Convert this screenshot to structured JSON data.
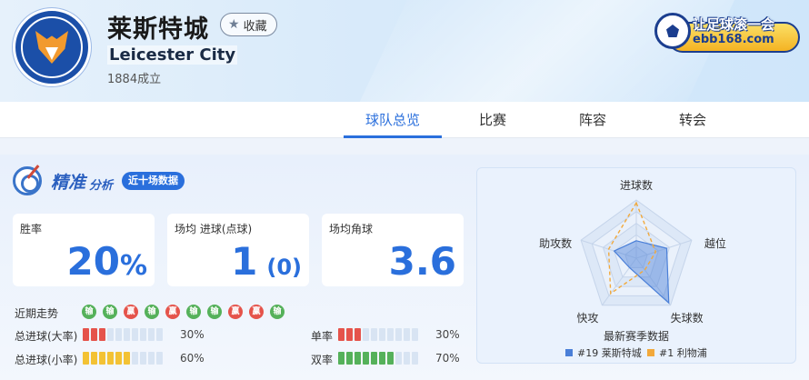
{
  "header": {
    "team_name_cn": "莱斯特城",
    "favorite_label": "收藏",
    "team_name_en": "Leicester City",
    "founded": "1884成立",
    "brand_title": "让足球滚一会",
    "brand_url": "ebb168.com"
  },
  "tabs": [
    {
      "label": "球队总览",
      "active": true
    },
    {
      "label": "比赛",
      "active": false
    },
    {
      "label": "阵容",
      "active": false
    },
    {
      "label": "转会",
      "active": false
    }
  ],
  "analysis": {
    "title_main": "精准",
    "title_sub": "分析",
    "badge": "近十场数据"
  },
  "stats": {
    "win_rate": {
      "label": "胜率",
      "value": "20",
      "unit": "%"
    },
    "goals": {
      "label": "场均 进球(点球)",
      "value": "1",
      "sub": "(0)"
    },
    "corners": {
      "label": "场均角球",
      "value": "3.6"
    }
  },
  "recent_form": {
    "label": "近期走势",
    "results": [
      {
        "text": "输",
        "type": "lose"
      },
      {
        "text": "输",
        "type": "lose"
      },
      {
        "text": "赢",
        "type": "win"
      },
      {
        "text": "输",
        "type": "lose"
      },
      {
        "text": "赢",
        "type": "win"
      },
      {
        "text": "输",
        "type": "lose"
      },
      {
        "text": "输",
        "type": "lose"
      },
      {
        "text": "赢",
        "type": "win"
      },
      {
        "text": "赢",
        "type": "win"
      },
      {
        "text": "输",
        "type": "lose"
      }
    ]
  },
  "rates": {
    "over_big": {
      "label": "总进球(大率)",
      "value": "30%",
      "filled": 3,
      "color": "red"
    },
    "over_small": {
      "label": "总进球(小率)",
      "value": "60%",
      "filled": 6,
      "color": "yellow"
    },
    "odd": {
      "label": "单率",
      "value": "30%",
      "filled": 3,
      "color": "red"
    },
    "even": {
      "label": "双率",
      "value": "70%",
      "filled": 7,
      "color": "green"
    }
  },
  "radar": {
    "axes": [
      "进球数",
      "越位",
      "失球数",
      "快攻",
      "助攻数"
    ],
    "caption": "最新赛季数据",
    "series": [
      {
        "name": "#19 莱斯特城",
        "color": "#4a7fd8",
        "values": [
          0.3,
          0.55,
          0.95,
          0.2,
          0.4
        ]
      },
      {
        "name": "#1 利物浦",
        "color": "#f2a93b",
        "values": [
          0.95,
          0.35,
          0.25,
          0.75,
          0.5
        ]
      }
    ]
  }
}
